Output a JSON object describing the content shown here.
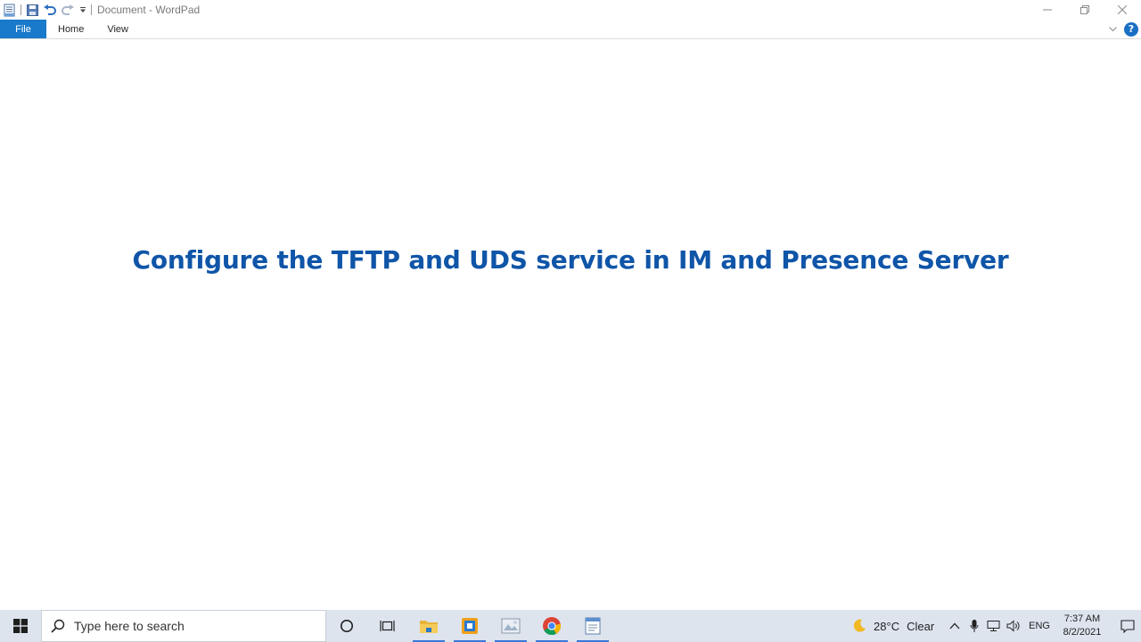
{
  "window": {
    "title": "Document - WordPad"
  },
  "quick_access": {
    "icons": [
      "wordpad-app-icon",
      "save-icon",
      "undo-icon",
      "redo-icon",
      "customize-dropdown-icon"
    ]
  },
  "ribbon": {
    "tabs": [
      {
        "label": "File"
      },
      {
        "label": "Home"
      },
      {
        "label": "View"
      }
    ],
    "help_label": "?"
  },
  "document": {
    "heading": "Configure the TFTP and UDS service in IM and Presence Server",
    "heading_color": "#0f55a8"
  },
  "taskbar": {
    "search_placeholder": "Type here to search",
    "apps": [
      "cortana-icon",
      "task-view-icon",
      "file-explorer-icon",
      "virtualbox-icon",
      "paint-icon",
      "chrome-icon",
      "wordpad-icon"
    ],
    "weather": {
      "temperature": "28°C",
      "condition": "Clear"
    },
    "language": "ENG",
    "time": "7:37 AM",
    "date": "8/2/2021"
  },
  "colors": {
    "file_tab": "#1979ca",
    "taskbar": "#dde4ee",
    "running_indicator": "#3b78d8"
  }
}
